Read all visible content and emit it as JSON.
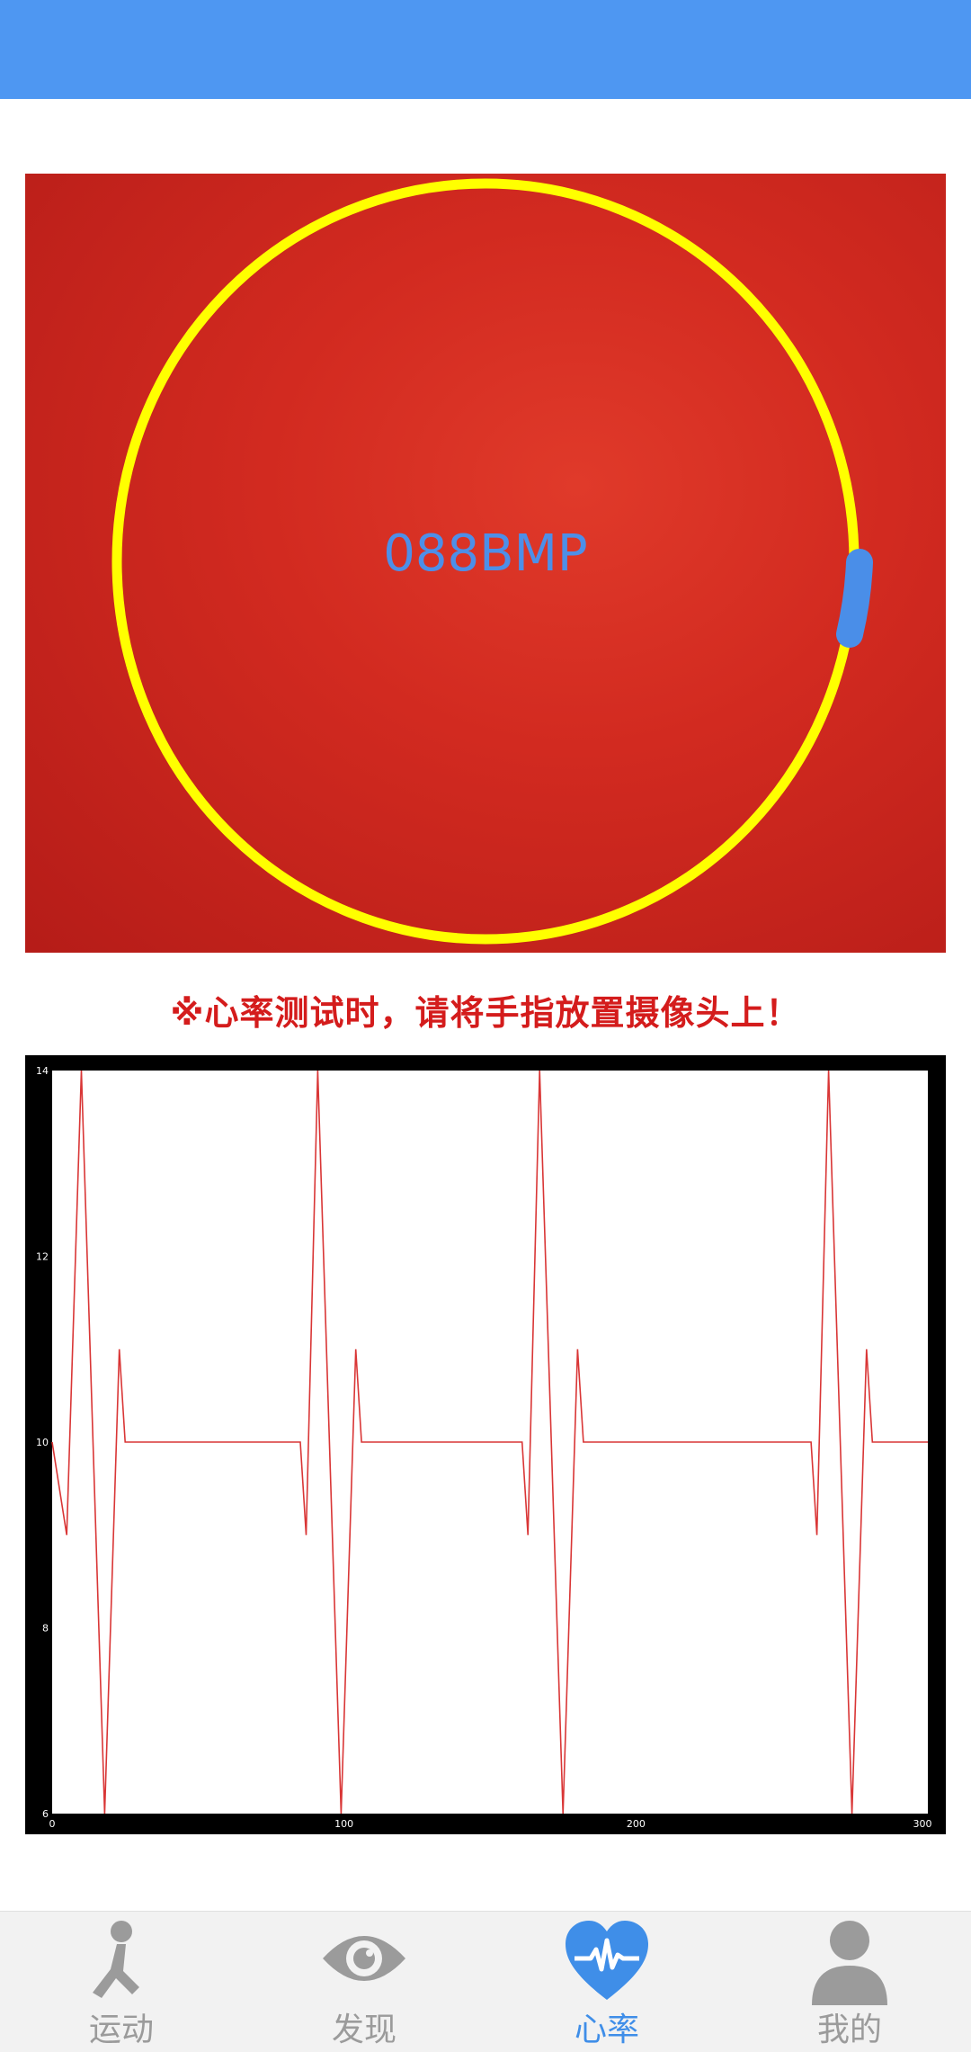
{
  "camera": {
    "bpm_text": "088BMP"
  },
  "hint": "※心率测试时，请将手指放置摄像头上！",
  "chart_data": {
    "type": "line",
    "title": "",
    "xlabel": "",
    "ylabel": "",
    "xlim": [
      0,
      300
    ],
    "ylim": [
      6,
      14
    ],
    "x_ticks": [
      "0",
      "100",
      "200",
      "300"
    ],
    "y_ticks": [
      "6",
      "8",
      "10",
      "12",
      "14"
    ],
    "series": [
      {
        "color": "#d93636",
        "x": [
          0,
          5,
          10,
          18,
          23,
          25,
          85,
          87,
          91,
          99,
          104,
          106,
          161,
          163,
          167,
          175,
          180,
          182,
          260,
          262,
          266,
          274,
          279,
          281,
          300
        ],
        "y": [
          10,
          9,
          14,
          6,
          11,
          10,
          10,
          9,
          14,
          6,
          11,
          10,
          10,
          9,
          14,
          6,
          11,
          10,
          10,
          9,
          14,
          6,
          11,
          10,
          10
        ]
      }
    ]
  },
  "tabbar": {
    "items": [
      {
        "label": "运动",
        "icon": "running-person-icon",
        "active": false
      },
      {
        "label": "发现",
        "icon": "eye-icon",
        "active": false
      },
      {
        "label": "心率",
        "icon": "heart-pulse-icon",
        "active": true
      },
      {
        "label": "我的",
        "icon": "person-icon",
        "active": false
      }
    ]
  },
  "colors": {
    "status_bar": "#4e97f2",
    "ring": "#ffff00",
    "progress_arc": "#4a8ee8",
    "active_tab": "#3f8ee8",
    "inactive_tab": "#9b9b9b"
  }
}
